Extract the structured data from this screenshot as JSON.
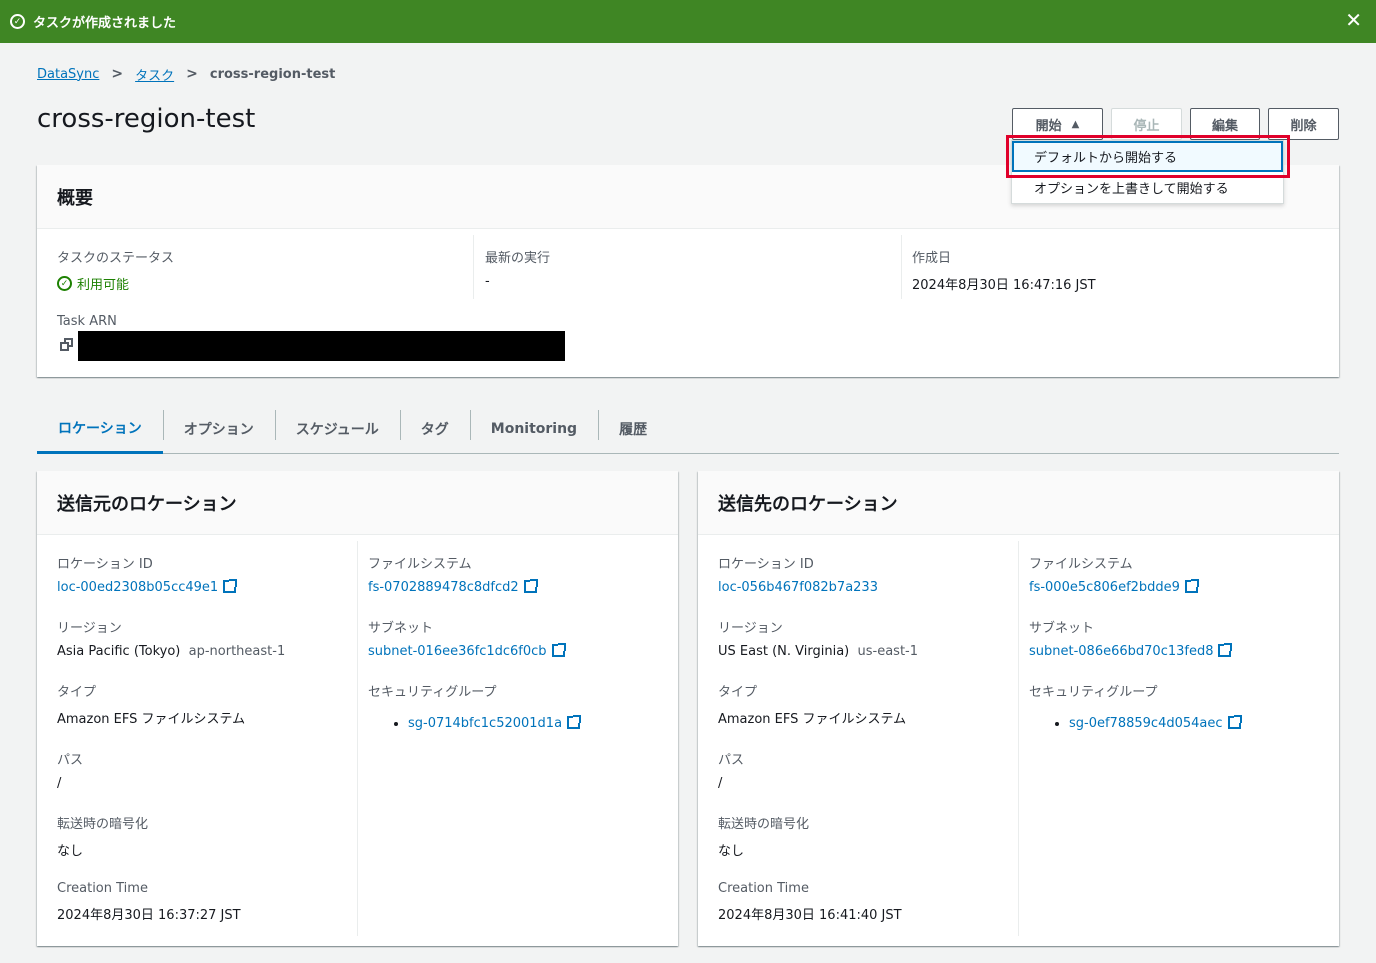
{
  "flash": {
    "message": "タスクが作成されました"
  },
  "breadcrumb": {
    "root": "DataSync",
    "section": "タスク",
    "current": "cross-region-test"
  },
  "page_title": "cross-region-test",
  "actions": {
    "start": "開始",
    "stop": "停止",
    "edit": "編集",
    "delete": "削除"
  },
  "start_menu": {
    "items": [
      "デフォルトから開始する",
      "オプションを上書きして開始する"
    ]
  },
  "overview": {
    "title": "概要",
    "status_label": "タスクのステータス",
    "status_value": "利用可能",
    "last_run_label": "最新の実行",
    "last_run_value": "-",
    "created_label": "作成日",
    "created_value": "2024年8月30日 16:47:16 JST",
    "arn_label": "Task ARN"
  },
  "tabs": [
    "ロケーション",
    "オプション",
    "スケジュール",
    "タグ",
    "Monitoring",
    "履歴"
  ],
  "source": {
    "title": "送信元のロケーション",
    "location_id_label": "ロケーション ID",
    "location_id": "loc-00ed2308b05cc49e1",
    "region_label": "リージョン",
    "region_name": "Asia Pacific (Tokyo)",
    "region_code": "ap-northeast-1",
    "type_label": "タイプ",
    "type": "Amazon EFS ファイルシステム",
    "path_label": "パス",
    "path": "/",
    "encryption_label": "転送時の暗号化",
    "encryption": "なし",
    "creation_label": "Creation Time",
    "creation": "2024年8月30日 16:37:27 JST",
    "fs_label": "ファイルシステム",
    "fs": "fs-0702889478c8dfcd2",
    "subnet_label": "サブネット",
    "subnet": "subnet-016ee36fc1dc6f0cb",
    "sg_label": "セキュリティグループ",
    "sg": "sg-0714bfc1c52001d1a"
  },
  "destination": {
    "title": "送信先のロケーション",
    "location_id_label": "ロケーション ID",
    "location_id": "loc-056b467f082b7a233",
    "region_label": "リージョン",
    "region_name": "US East (N. Virginia)",
    "region_code": "us-east-1",
    "type_label": "タイプ",
    "type": "Amazon EFS ファイルシステム",
    "path_label": "パス",
    "path": "/",
    "encryption_label": "転送時の暗号化",
    "encryption": "なし",
    "creation_label": "Creation Time",
    "creation": "2024年8月30日 16:41:40 JST",
    "fs_label": "ファイルシステム",
    "fs": "fs-000e5c806ef2bdde9",
    "subnet_label": "サブネット",
    "subnet": "subnet-086e66bd70c13fed8",
    "sg_label": "セキュリティグループ",
    "sg": "sg-0ef78859c4d054aec"
  },
  "colors": {
    "success": "#3f8624",
    "link": "#0073bb",
    "highlight": "#e0002a"
  }
}
